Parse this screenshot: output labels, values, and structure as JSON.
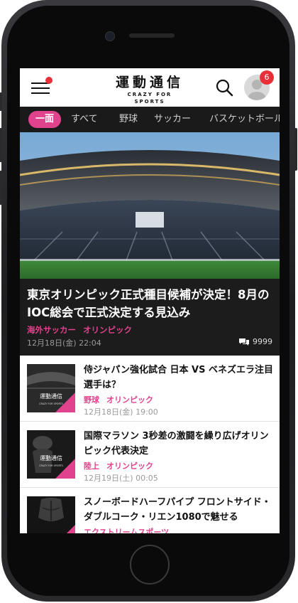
{
  "header": {
    "logo_main": "運動通信",
    "logo_sub": "CRAZY FOR SPORTS",
    "notification_count": "6"
  },
  "tabs": [
    {
      "label": "一面",
      "active": true
    },
    {
      "label": "すべて",
      "active": false
    },
    {
      "label": "野球",
      "active": false
    },
    {
      "label": "サッカー",
      "active": false
    },
    {
      "label": "バスケットボール",
      "active": false
    }
  ],
  "featured": {
    "title": "東京オリンピック正式種目候補が決定！8月のIOC総会で正式決定する見込み",
    "categories": [
      "海外サッカー",
      "オリンピック"
    ],
    "date": "12月18日(金) 22:04",
    "comments": "9999"
  },
  "articles": [
    {
      "title": "侍ジャパン強化試合 日本 VS ベネズエラ注目選手は？",
      "categories": [
        "野球",
        "オリンピック"
      ],
      "date": "12月18日(金) 19:00",
      "thumb_logo": "運動通信",
      "thumb_sub": "CRAZY FOR SPORTS"
    },
    {
      "title": "国際マラソン 3秒差の激闘を繰り広げオリンピック代表決定",
      "categories": [
        "陸上",
        "オリンピック"
      ],
      "date": "12月19日(土) 00:05",
      "thumb_logo": "運動通信",
      "thumb_sub": "CRAZY FOR SPORTS"
    },
    {
      "title": "スノーボードハーフパイプ フロントサイド・ダブルコーク・リエン1080で魅せる",
      "categories": [
        "エクストリームスポーツ"
      ],
      "date": "",
      "thumb_logo": "",
      "thumb_sub": ""
    }
  ],
  "colors": {
    "accent": "#e0428d",
    "badge": "#e8303b",
    "tab_bar": "#1a1a1a"
  }
}
